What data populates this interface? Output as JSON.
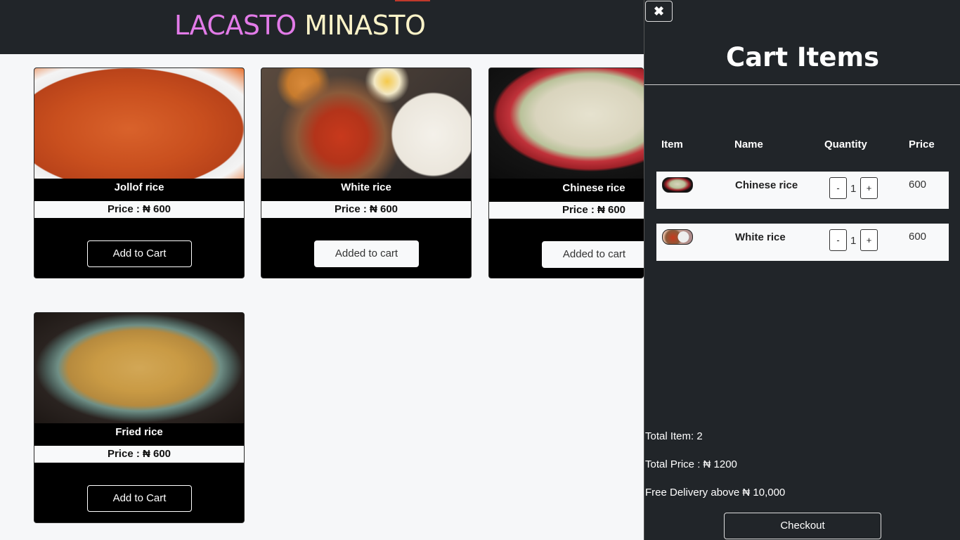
{
  "header": {
    "brand_part1": "LACASTO",
    "brand_part2": "MINASTO"
  },
  "products": [
    {
      "name": "Jollof rice",
      "price_text": "Price : ₦ 600",
      "button_label": "Add to Cart"
    },
    {
      "name": "White rice",
      "price_text": "Price : ₦ 600",
      "button_label": "Added to cart"
    },
    {
      "name": "Chinese rice",
      "price_text": "Price : ₦ 600",
      "button_label": "Added to cart"
    },
    {
      "name": "Fried rice",
      "price_text": "Price : ₦ 600",
      "button_label": "Add to Cart"
    }
  ],
  "cart": {
    "close_icon": "close-icon",
    "title": "Cart Items",
    "columns": [
      "Item",
      "Name",
      "Quantity",
      "Price"
    ],
    "items": [
      {
        "name": "Chinese rice",
        "quantity": "1",
        "price": "600",
        "minus": "-",
        "plus": "+"
      },
      {
        "name": "White rice",
        "quantity": "1",
        "price": "600",
        "minus": "-",
        "plus": "+"
      }
    ],
    "total_items": "Total Item: 2",
    "total_price": "Total Price : ₦ 1200",
    "delivery_note": "Free Delivery above ₦ 10,000",
    "checkout_label": "Checkout"
  },
  "colors": {
    "header_bg": "#212529",
    "brand_pink": "#e27be8",
    "brand_cream": "#fbf3c8"
  }
}
